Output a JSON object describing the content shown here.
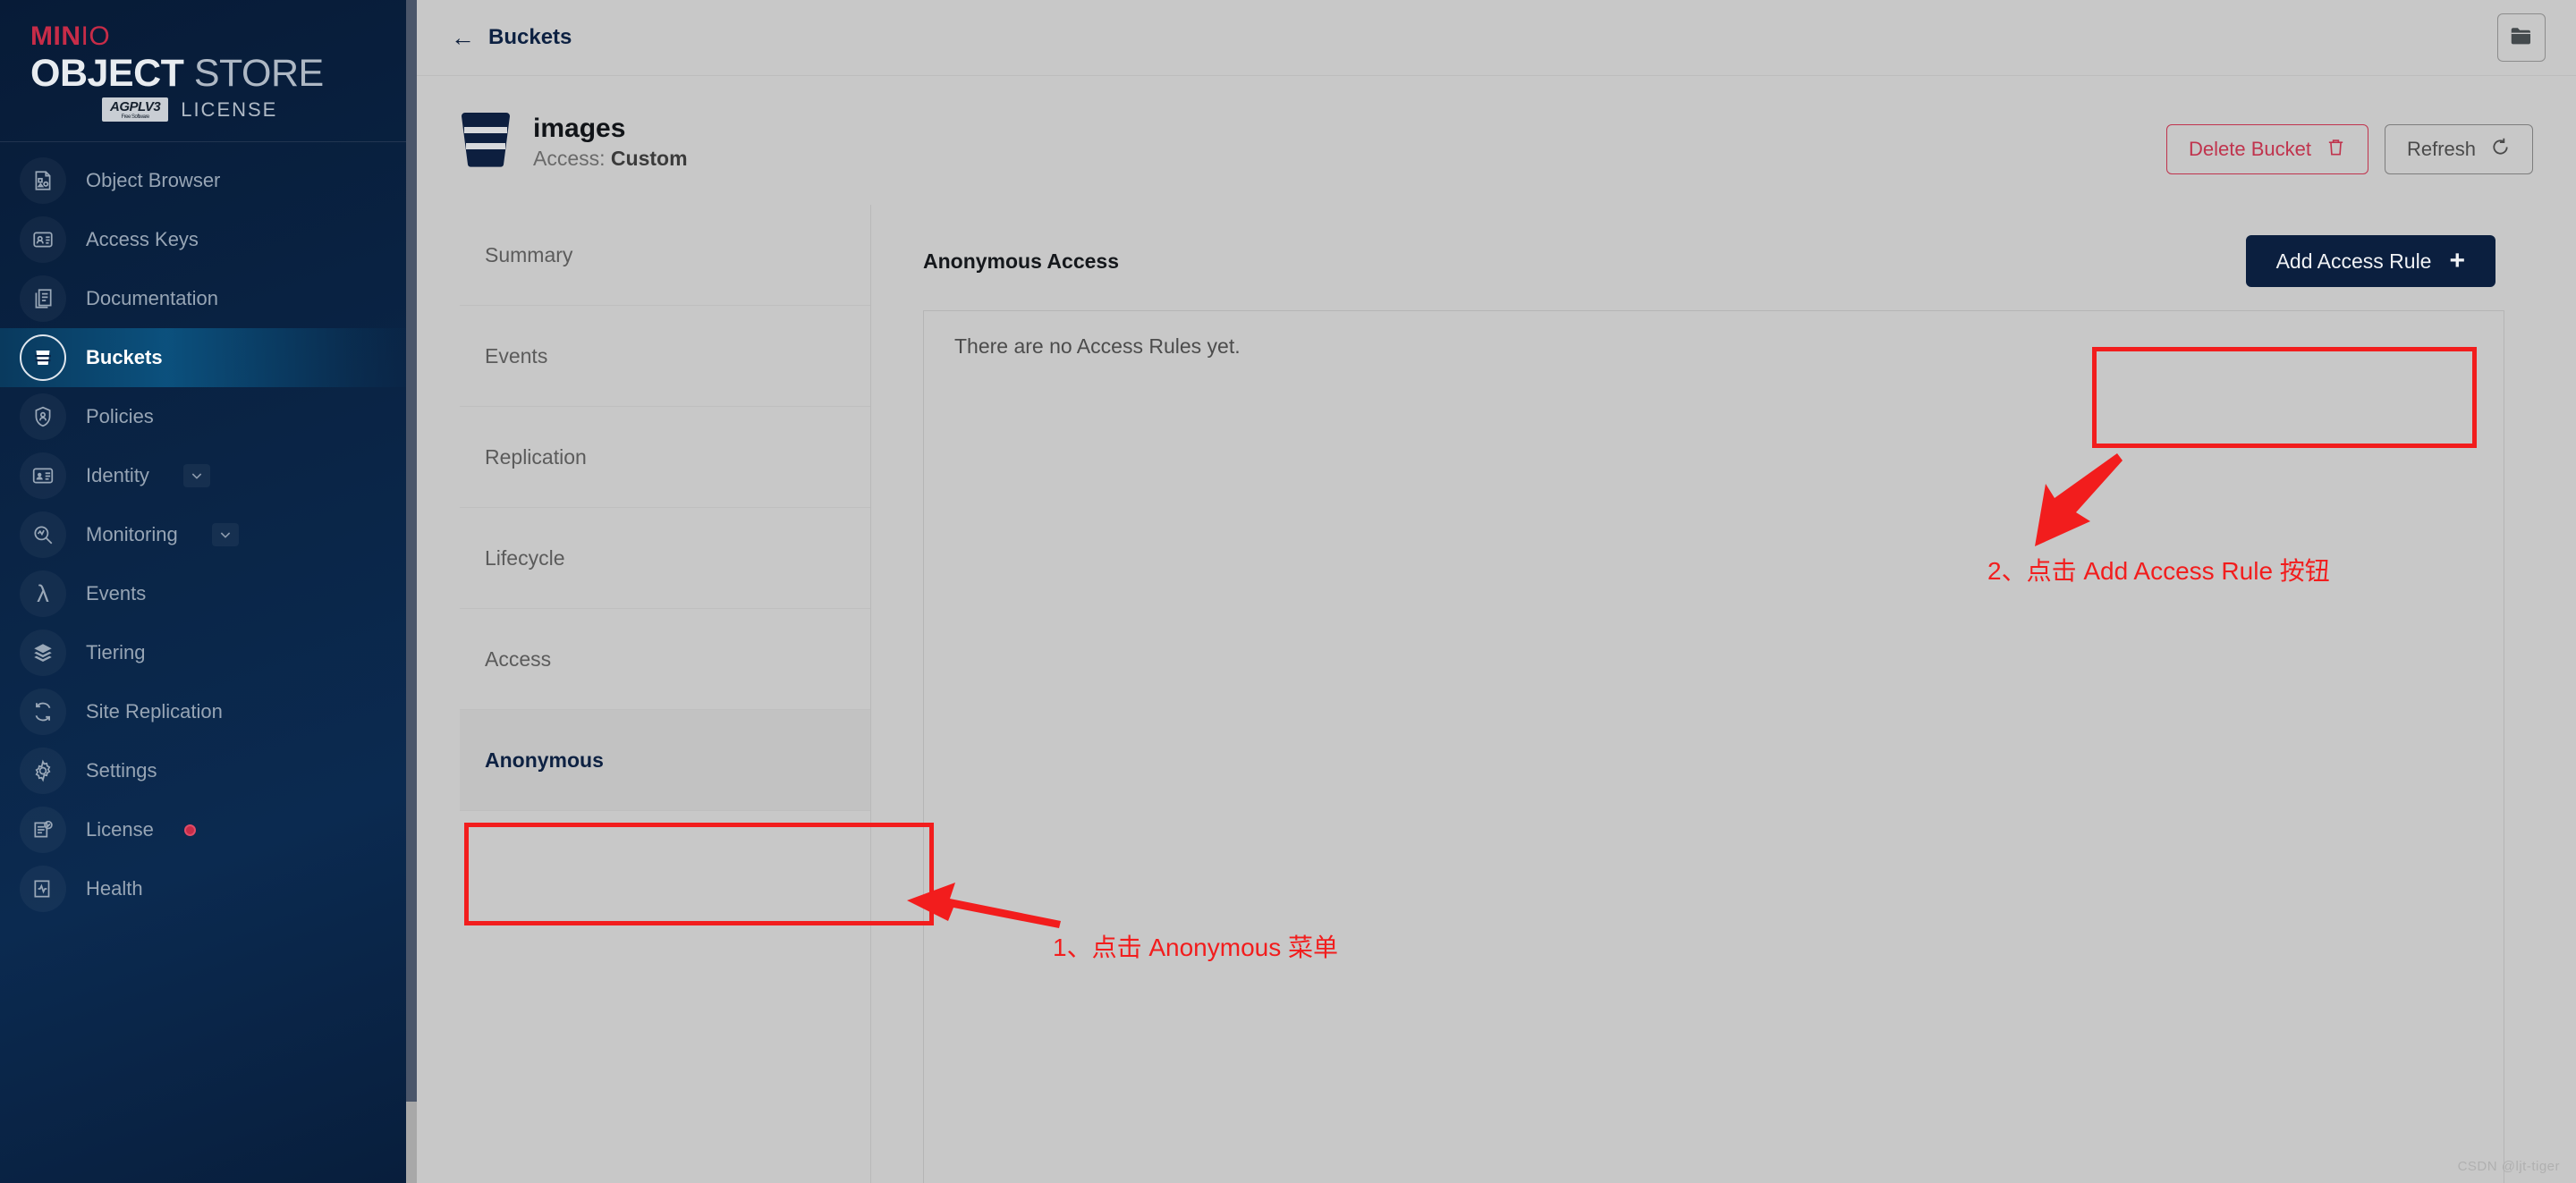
{
  "brand": {
    "minio": "MIN",
    "minio_o": "IO",
    "object": "OBJECT",
    "store": "STORE",
    "agpl": "AGPL",
    "agpl_v": "V3",
    "agpl_sub": "Free Software",
    "license": "LICENSE"
  },
  "sidebar": {
    "items": [
      {
        "label": "Object Browser",
        "icon": "object-browser-icon",
        "active": false,
        "chevron": false,
        "badge": false
      },
      {
        "label": "Access Keys",
        "icon": "access-keys-icon",
        "active": false,
        "chevron": false,
        "badge": false
      },
      {
        "label": "Documentation",
        "icon": "documentation-icon",
        "active": false,
        "chevron": false,
        "badge": false
      },
      {
        "label": "Buckets",
        "icon": "buckets-icon",
        "active": true,
        "chevron": false,
        "badge": false
      },
      {
        "label": "Policies",
        "icon": "policies-icon",
        "active": false,
        "chevron": false,
        "badge": false
      },
      {
        "label": "Identity",
        "icon": "identity-icon",
        "active": false,
        "chevron": true,
        "badge": false
      },
      {
        "label": "Monitoring",
        "icon": "monitoring-icon",
        "active": false,
        "chevron": true,
        "badge": false
      },
      {
        "label": "Events",
        "icon": "events-lambda-icon",
        "active": false,
        "chevron": false,
        "badge": false
      },
      {
        "label": "Tiering",
        "icon": "tiering-icon",
        "active": false,
        "chevron": false,
        "badge": false
      },
      {
        "label": "Site Replication",
        "icon": "site-replication-icon",
        "active": false,
        "chevron": false,
        "badge": false
      },
      {
        "label": "Settings",
        "icon": "settings-gear-icon",
        "active": false,
        "chevron": false,
        "badge": false
      },
      {
        "label": "License",
        "icon": "license-icon",
        "active": false,
        "chevron": false,
        "badge": true
      },
      {
        "label": "Health",
        "icon": "health-icon",
        "active": false,
        "chevron": false,
        "badge": false
      }
    ]
  },
  "topbar": {
    "breadcrumb": "Buckets",
    "back_arrow": "←",
    "folder_button": "folder-icon"
  },
  "bucket": {
    "name": "images",
    "access_label": "Access:",
    "access_value": "Custom",
    "delete_label": "Delete Bucket",
    "refresh_label": "Refresh"
  },
  "tabs": [
    {
      "label": "Summary",
      "selected": false
    },
    {
      "label": "Events",
      "selected": false
    },
    {
      "label": "Replication",
      "selected": false
    },
    {
      "label": "Lifecycle",
      "selected": false
    },
    {
      "label": "Access",
      "selected": false
    },
    {
      "label": "Anonymous",
      "selected": true
    }
  ],
  "pane": {
    "title": "Anonymous Access",
    "add_rule_label": "Add Access Rule",
    "plus": "+",
    "empty_message": "There are no Access Rules yet."
  },
  "annotations": {
    "step1": "1、点击 Anonymous 菜单",
    "step2": "2、点击 Add Access Rule 按钮",
    "color": "#f21d1d"
  },
  "watermark": "CSDN @ljt-tiger"
}
